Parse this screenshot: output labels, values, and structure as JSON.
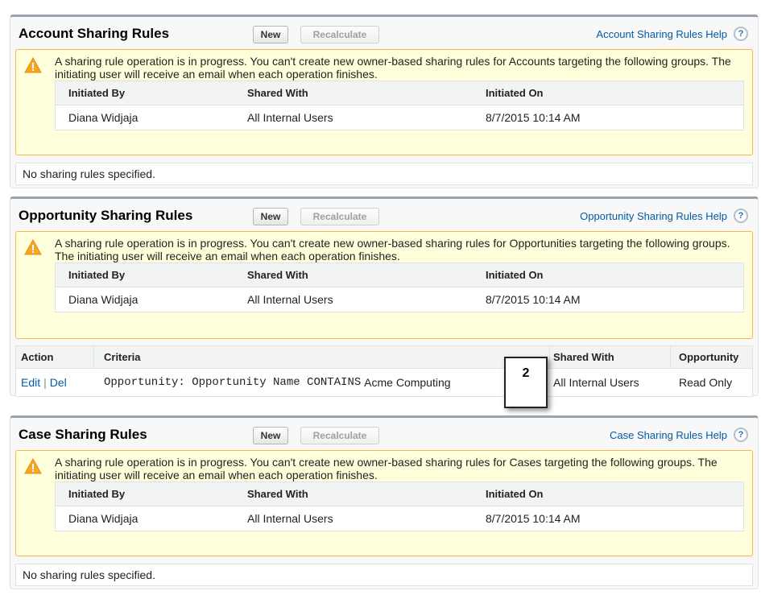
{
  "sections": {
    "account": {
      "title": "Account Sharing Rules",
      "new_label": "New",
      "recalc_label": "Recalculate",
      "help_label": "Account Sharing Rules Help",
      "warning_text": "A sharing rule operation is in progress. You can't create new owner-based sharing rules for Accounts targeting the following groups. The initiating user will receive an email when each operation finishes.",
      "op_headers": [
        "Initiated By",
        "Shared With",
        "Initiated On"
      ],
      "op_row": [
        "Diana Widjaja",
        "All Internal Users",
        "8/7/2015 10:14 AM"
      ],
      "empty_text": "No sharing rules specified."
    },
    "opportunity": {
      "title": "Opportunity Sharing Rules",
      "new_label": "New",
      "recalc_label": "Recalculate",
      "help_label": "Opportunity Sharing Rules Help",
      "warning_text": "A sharing rule operation is in progress. You can't create new owner-based sharing rules for Opportunities targeting the following groups. The initiating user will receive an email when each operation finishes.",
      "op_headers": [
        "Initiated By",
        "Shared With",
        "Initiated On"
      ],
      "op_row": [
        "Diana Widjaja",
        "All Internal Users",
        "8/7/2015 10:14 AM"
      ],
      "rules_headers": [
        "Action",
        "Criteria",
        "Shared With",
        "Opportunity"
      ],
      "rule": {
        "edit": "Edit",
        "separator": "|",
        "del": "Del",
        "criteria_code": "Opportunity: Opportunity Name CONTAINS",
        "criteria_value": "Acme Computing",
        "shared_with": "All Internal Users",
        "access": "Read Only"
      }
    },
    "case": {
      "title": "Case Sharing Rules",
      "new_label": "New",
      "recalc_label": "Recalculate",
      "help_label": "Case Sharing Rules Help",
      "warning_text": "A sharing rule operation is in progress. You can't create new owner-based sharing rules for Cases targeting the following groups. The initiating user will receive an email when each operation finishes.",
      "op_headers": [
        "Initiated By",
        "Shared With",
        "Initiated On"
      ],
      "op_row": [
        "Diana Widjaja",
        "All Internal Users",
        "8/7/2015 10:14 AM"
      ],
      "empty_text": "No sharing rules specified."
    }
  },
  "help_icon_glyph": "?",
  "callout_number": "2",
  "colors": {
    "link": "#015ba7",
    "warning_bg": "#ffffdc",
    "warning_border": "#f9b54a",
    "warning_icon": "#f5a623"
  }
}
